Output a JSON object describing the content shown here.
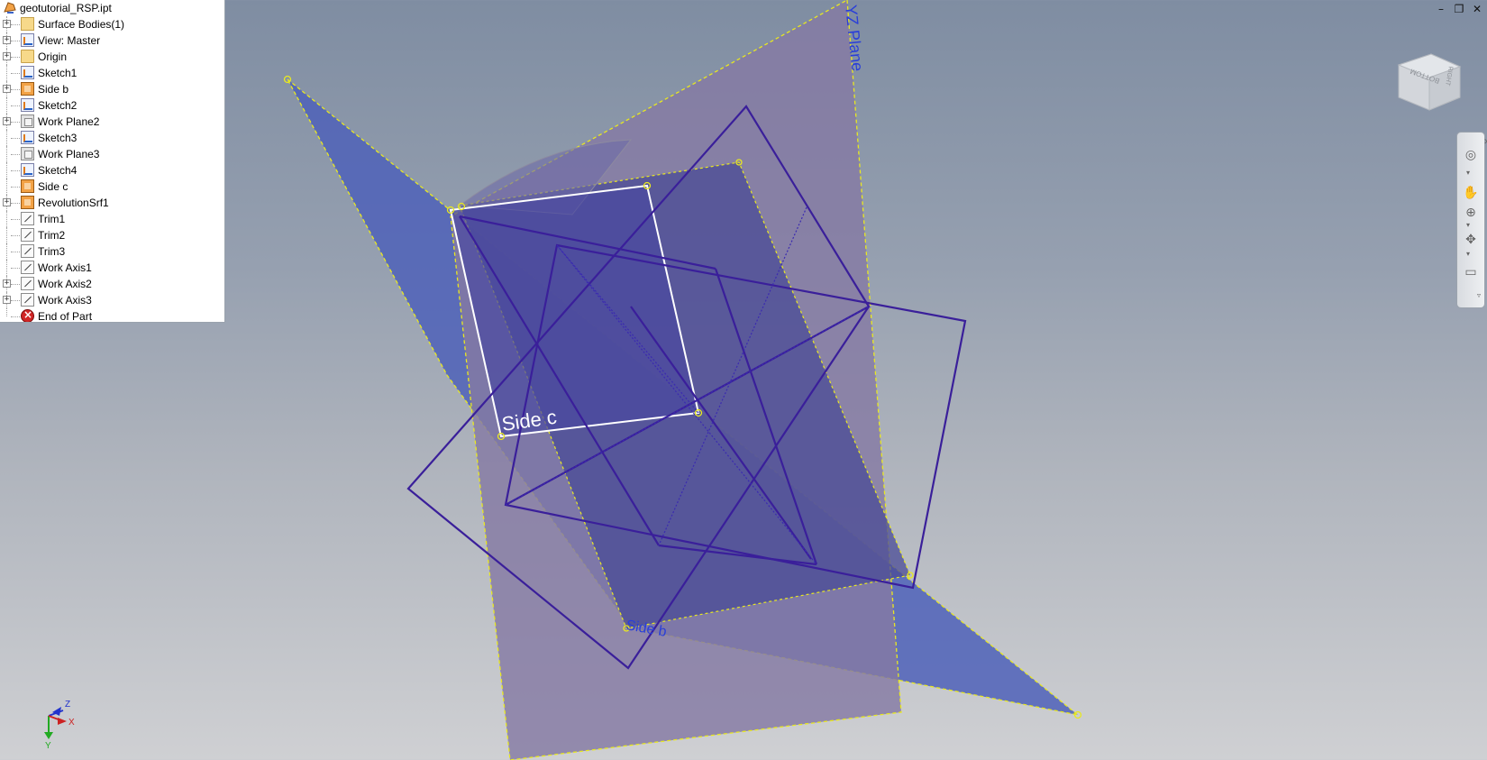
{
  "browser": {
    "file_name": "geotutorial_RSP.ipt",
    "items": [
      {
        "label": "Surface Bodies(1)",
        "icon": "surface-bodies-icon",
        "expandable": true
      },
      {
        "label": "View: Master",
        "icon": "view-icon",
        "expandable": true
      },
      {
        "label": "Origin",
        "icon": "folder-icon",
        "expandable": true
      },
      {
        "label": "Sketch1",
        "icon": "sketch-icon",
        "expandable": false
      },
      {
        "label": "Side b",
        "icon": "boundary-patch-icon",
        "expandable": true
      },
      {
        "label": "Sketch2",
        "icon": "sketch-icon",
        "expandable": false
      },
      {
        "label": "Work Plane2",
        "icon": "work-plane-icon",
        "expandable": true
      },
      {
        "label": "Sketch3",
        "icon": "sketch-icon",
        "expandable": false
      },
      {
        "label": "Work Plane3",
        "icon": "work-plane-icon",
        "expandable": false
      },
      {
        "label": "Sketch4",
        "icon": "sketch-icon",
        "expandable": false
      },
      {
        "label": "Side c",
        "icon": "boundary-patch-icon",
        "expandable": false
      },
      {
        "label": "RevolutionSrf1",
        "icon": "revolve-icon",
        "expandable": true
      },
      {
        "label": "Trim1",
        "icon": "trim-icon",
        "expandable": false
      },
      {
        "label": "Trim2",
        "icon": "trim-icon",
        "expandable": false
      },
      {
        "label": "Trim3",
        "icon": "trim-icon",
        "expandable": false
      },
      {
        "label": "Work Axis1",
        "icon": "work-axis-icon",
        "expandable": false
      },
      {
        "label": "Work Axis2",
        "icon": "work-axis-icon",
        "expandable": true
      },
      {
        "label": "Work Axis3",
        "icon": "work-axis-icon",
        "expandable": true
      },
      {
        "label": "End of Part",
        "icon": "end-of-part-icon",
        "expandable": false
      }
    ]
  },
  "viewport": {
    "plane_label": "YZ Plane",
    "side_c_label": "Side c",
    "side_b_label": "Side b",
    "viewcube_faces": {
      "front": "BOTTOM",
      "side": "RIGHT"
    },
    "triad": {
      "x": "X",
      "y": "Y",
      "z": "Z"
    }
  },
  "window_controls": {
    "minimize": "–",
    "restore": "❐",
    "close": "✕"
  },
  "colors": {
    "blue_plane": "#4f60b8",
    "purple_plane": "#8a7ba0",
    "sketch_line": "#3a1f9a",
    "highlight": "#ffffff",
    "boundary": "#e8e820"
  }
}
